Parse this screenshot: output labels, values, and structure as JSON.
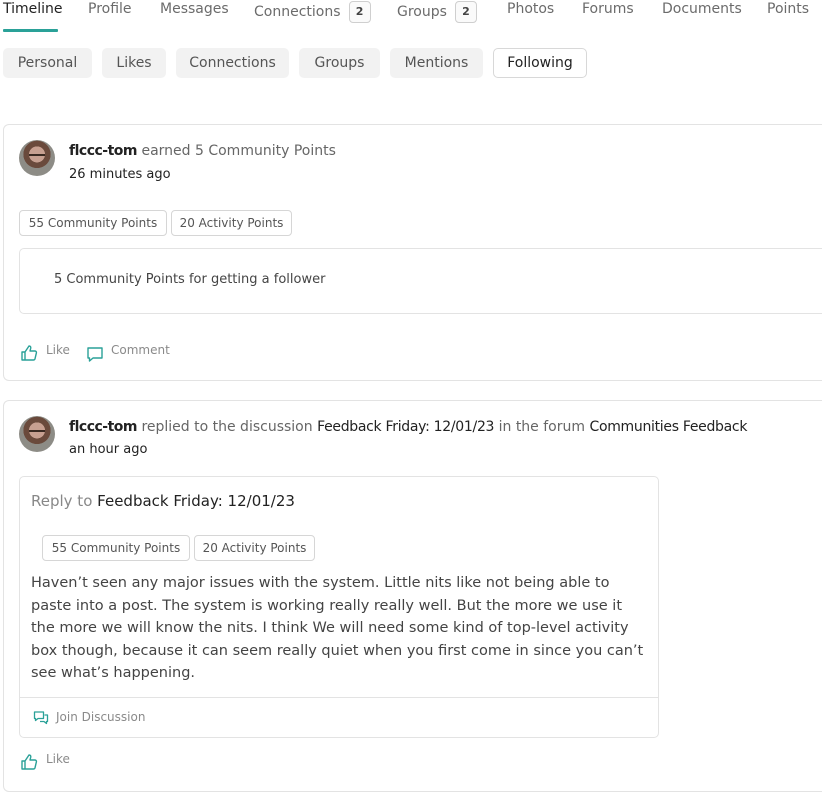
{
  "tabs": [
    {
      "label": "Timeline",
      "active": true
    },
    {
      "label": "Profile"
    },
    {
      "label": "Messages"
    },
    {
      "label": "Connections",
      "badge": "2"
    },
    {
      "label": "Groups",
      "badge": "2"
    },
    {
      "label": "Photos"
    },
    {
      "label": "Forums"
    },
    {
      "label": "Documents"
    },
    {
      "label": "Points"
    }
  ],
  "subtabs": [
    "Personal",
    "Likes",
    "Connections",
    "Groups",
    "Mentions",
    "Following"
  ],
  "active_subtab": "Following",
  "accent_color": "#2aa198",
  "posts": [
    {
      "user": "flccc-tom",
      "action_text": "earned 5 Community Points",
      "time": "26 minutes ago",
      "pills": [
        "55 Community Points",
        "20 Activity Points"
      ],
      "detail": "5 Community Points for getting a follower",
      "like_label": "Like",
      "comment_label": "Comment"
    },
    {
      "user": "flccc-tom",
      "action_pre": "replied to the discussion",
      "discussion": "Feedback Friday: 12/01/23",
      "action_mid": "in the forum",
      "forum": "Communities Feedback",
      "time": "an hour ago",
      "reply_prefix": "Reply to",
      "reply_title": "Feedback Friday: 12/01/23",
      "pills": [
        "55 Community Points",
        "20 Activity Points"
      ],
      "body": "Haven’t seen any major issues with the system. Little nits like not being able to paste into a post. The system is working really really well. But the more we use it the more we will know the nits. I think We will need some kind of top-level activity box though, because it can seem really quiet when you first come in since you can’t see what’s happening.",
      "join_label": "Join Discussion",
      "like_label": "Like"
    }
  ]
}
